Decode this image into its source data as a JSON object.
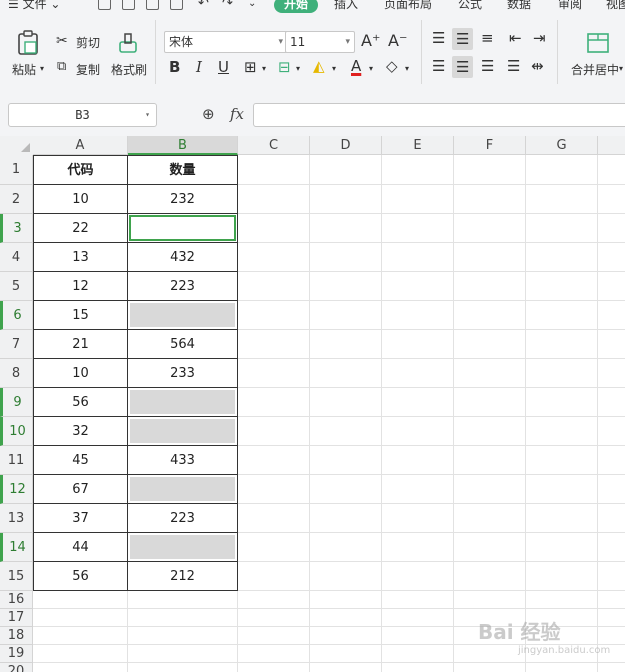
{
  "menubar": {
    "items": [
      "☰ 文件 ⌄",
      "开始",
      "插入",
      "页面布局",
      "公式",
      "数据",
      "审阅",
      "视图"
    ],
    "active_index": 1
  },
  "ribbon": {
    "paste_label": "粘贴",
    "cut_label": "剪切",
    "copy_label": "复制",
    "format_painter_label": "格式刷",
    "font_name": "宋体",
    "font_size": "11",
    "grow_font": "A⁺",
    "shrink_font": "A⁻",
    "bold": "B",
    "italic": "I",
    "underline": "U",
    "merge_center_label": "合并居中",
    "accent_color": "#3fb07b",
    "font_color": "#e02020"
  },
  "formula_bar": {
    "name_box": "B3",
    "fx_label": "fx",
    "formula": ""
  },
  "sheet": {
    "columns": [
      "A",
      "B",
      "C",
      "D",
      "E",
      "F",
      "G"
    ],
    "selected_column": "B",
    "row_numbers": [
      "1",
      "2",
      "3",
      "4",
      "5",
      "6",
      "7",
      "8",
      "9",
      "10",
      "11",
      "12",
      "13",
      "14",
      "15",
      "16",
      "17",
      "18",
      "19",
      "20"
    ],
    "marked_rows": [
      "3",
      "6",
      "9",
      "10",
      "12",
      "14"
    ],
    "header": {
      "a": "代码",
      "b": "数量"
    },
    "rows": [
      {
        "a": "10",
        "b": "232",
        "state": "value"
      },
      {
        "a": "22",
        "b": "",
        "state": "active"
      },
      {
        "a": "13",
        "b": "432",
        "state": "value"
      },
      {
        "a": "12",
        "b": "223",
        "state": "value"
      },
      {
        "a": "15",
        "b": "",
        "state": "blank"
      },
      {
        "a": "21",
        "b": "564",
        "state": "value"
      },
      {
        "a": "10",
        "b": "233",
        "state": "value"
      },
      {
        "a": "56",
        "b": "",
        "state": "blank"
      },
      {
        "a": "32",
        "b": "",
        "state": "blank"
      },
      {
        "a": "45",
        "b": "433",
        "state": "value"
      },
      {
        "a": "67",
        "b": "",
        "state": "blank"
      },
      {
        "a": "37",
        "b": "223",
        "state": "value"
      },
      {
        "a": "44",
        "b": "",
        "state": "blank"
      },
      {
        "a": "56",
        "b": "212",
        "state": "value"
      }
    ],
    "selection_color": "#3fa34d",
    "blank_fill_color": "#d9d9d9"
  },
  "watermark": {
    "text": "Bai 经验",
    "sub": "jingyan.baidu.com"
  }
}
